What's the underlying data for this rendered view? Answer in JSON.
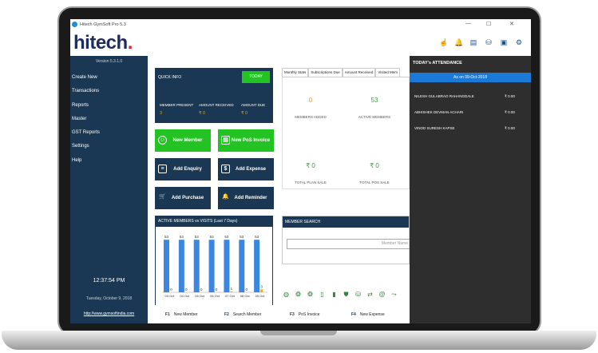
{
  "window": {
    "title": "Hitech GymSoft Pro 5.3",
    "minimize": "—",
    "maximize": "☐",
    "close": "✕"
  },
  "logo": {
    "text_main": "hitech",
    "color": "#1f2c5c",
    "dot_color": "#e4262c"
  },
  "toolbar_icons": [
    "user-hand-icon",
    "bell-icon",
    "document-icon",
    "coins-icon",
    "card-icon",
    "gear-icon"
  ],
  "sidebar": {
    "version": "Version 5.3.1.0",
    "items": [
      "Create New",
      "Transactions",
      "Reports",
      "Master",
      "GST Reports",
      "Settings",
      "Help"
    ],
    "clock": "12:37:54 PM",
    "date": "Tuesday, October 9, 2018",
    "url": "http://www.gymsoftindia.com"
  },
  "quick_info": {
    "title": "QUICK INFO",
    "today_button": "TODAY",
    "stats": [
      {
        "label": "MEMBER PRESENT",
        "value": "3"
      },
      {
        "label": "AMOUNT RECEIVED",
        "value": "₹ 0"
      },
      {
        "label": "AMOUNT DUE",
        "value": "₹ 0"
      }
    ]
  },
  "actions": {
    "new_member": "New Member",
    "new_pos_invoice": "New PoS Invoice",
    "add_enquiry": "Add Enquiry",
    "add_expense": "Add Expense",
    "add_purchase": "Add Purchase",
    "add_reminder": "Add Reminder"
  },
  "chart_title": "ACTIVE MEMBERS vs VISITS (Last 7 Days)",
  "chart_data": {
    "type": "bar",
    "categories": [
      "03 Oct",
      "04 Oct",
      "05 Oct",
      "06 Oct",
      "07 Oct",
      "08 Oct",
      "09 Oct"
    ],
    "series": [
      {
        "values": [
          53,
          53,
          53,
          53,
          53,
          53,
          53
        ],
        "color": "#3b86e0"
      },
      {
        "values": [
          0,
          0,
          0,
          0,
          1,
          0,
          3
        ],
        "color": "#f2b400"
      }
    ],
    "ylim": [
      0,
      58
    ]
  },
  "tabs": [
    "Monthly Stats",
    "Subscriptions Due",
    "Amount Received",
    "Visited Mem"
  ],
  "monthly_stats": {
    "members_added_value": "0",
    "members_added_label": "MEMBERS ADDED",
    "active_members_value": "53",
    "active_members_label": "ACTIVE MEMBERS",
    "plan_sale_value": "₹ 0",
    "plan_sale_label": "TOTAL PLAN SALE",
    "pos_sale_value": "₹ 0",
    "pos_sale_label": "TOTAL POS SALE"
  },
  "member_search": {
    "title": "MEMBER SEARCH",
    "placeholder": "Member Name"
  },
  "bottom_icons": [
    "globe-icon",
    "fingerprint-icon",
    "fingerprint-icon",
    "tablet-icon",
    "phone-icon",
    "shield-icon",
    "database-icon",
    "sync-icon",
    "email-icon",
    "share-icon"
  ],
  "attendance": {
    "title": "TODAY's ATTENDANCE",
    "as_on": "As on 09-Oct-2018",
    "rows": [
      {
        "name": "NILESH GULABRAO RAHANGDALE",
        "amount": "₹ 0.00"
      },
      {
        "name": "ABHISHEK DEVMAN ACHARI",
        "amount": "₹ 0.00"
      },
      {
        "name": "VINOD SURESH KAPSE",
        "amount": "₹ 0.00"
      }
    ]
  },
  "footer": [
    {
      "key": "F1",
      "label": "New Member"
    },
    {
      "key": "F2",
      "label": "Search Member"
    },
    {
      "key": "F3",
      "label": "PoS Invoice"
    },
    {
      "key": "F4",
      "label": "New Expense"
    }
  ]
}
